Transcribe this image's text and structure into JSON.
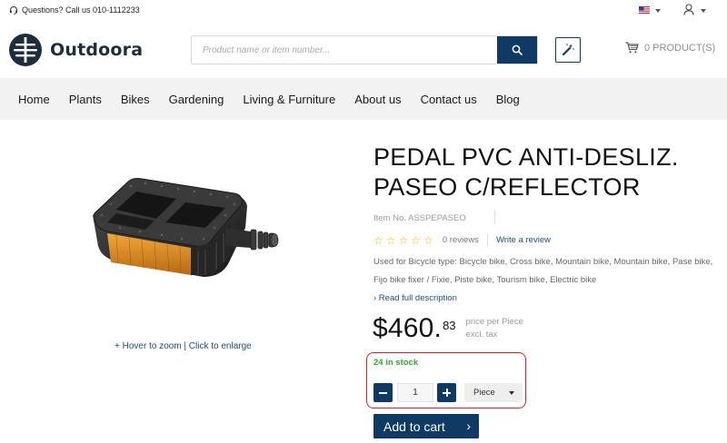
{
  "topbar": {
    "questions": "Questions? Call us 010-1112233",
    "icons": [
      "headset-icon",
      "us-flag-icon",
      "user-icon"
    ]
  },
  "header": {
    "logo_text": "Outdoora",
    "search_placeholder": "Product name or item number...",
    "cart_label": "0 PRODUCT(S)"
  },
  "nav": {
    "items": [
      "Home",
      "Plants",
      "Bikes",
      "Gardening",
      "Living & Furniture",
      "About us",
      "Contact us",
      "Blog"
    ]
  },
  "product": {
    "title": "PEDAL PVC ANTI-DESLIZ. PASEO C/REFLECTOR",
    "item_no": "Item No. ASSPEPASEO",
    "rating": 0,
    "max_rating": 5,
    "reviews": "0 reviews",
    "write_review": "Write a review",
    "description": "Used for Bicycle type: Bicycle bike, Cross bike, Mountain bike, Mountain bike, Pase bike, Fijo bike fixer / Fixie, Piste bike, Tourism bike, Electric bike",
    "read_more": "› Read full description",
    "zoom_hint": "+ Hover to zoom | Click to enlarge",
    "price_main": "$460.",
    "price_cents": "83",
    "price_unit_line1": "price per Piece",
    "price_unit_line2": "excl. tax",
    "stock": "24 in stock",
    "quantity": "1",
    "unit": "Piece",
    "add_to_cart": "Add to cart",
    "add_to_cart_arrow": "›"
  },
  "colors": {
    "primary": "#0f3a63",
    "stock_green": "#3aa335",
    "highlight_red": "#dd2222",
    "star": "#f0b400",
    "nav_bg": "#f2f2f2"
  }
}
